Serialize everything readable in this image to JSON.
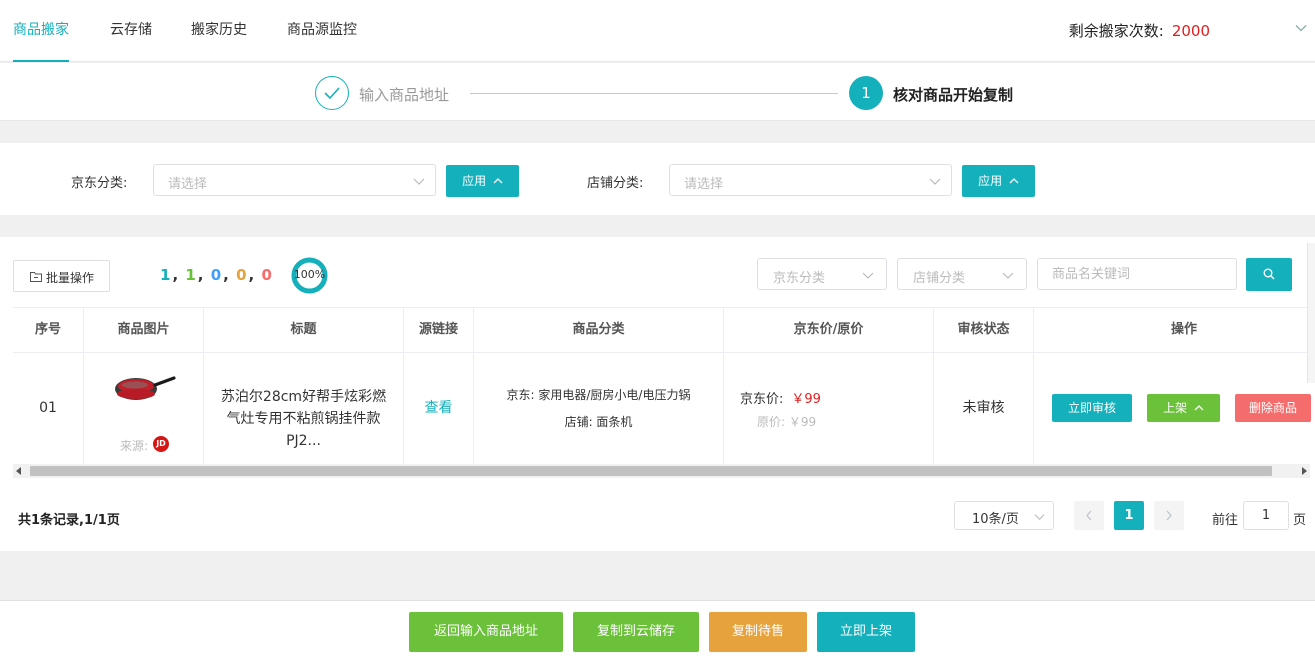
{
  "nav": {
    "tabs": [
      "商品搬家",
      "云存储",
      "搬家历史",
      "商品源监控"
    ],
    "remain_label": "剩余搬家次数:",
    "remain_value": "2000"
  },
  "steps": {
    "step1": "输入商品地址",
    "step2_num": "1",
    "step2": "核对商品开始复制"
  },
  "filter": {
    "jd_label": "京东分类:",
    "jd_placeholder": "请选择",
    "shop_label": "店铺分类:",
    "shop_placeholder": "请选择",
    "apply": "应用"
  },
  "toolbar": {
    "batch": "批量操作",
    "counts": [
      "1",
      "1",
      "0",
      "0",
      "0"
    ],
    "count_colors": [
      "#14b0bb",
      "#67c23a",
      "#409eff",
      "#e6a23c",
      "#f56c6c"
    ],
    "progress_text": "100%",
    "progress": 1.0,
    "jd_cat": "京东分类",
    "shop_cat": "店铺分类",
    "keyword_placeholder": "商品名关键词"
  },
  "table": {
    "headers": [
      "序号",
      "商品图片",
      "标题",
      "源链接",
      "商品分类",
      "京东价/原价",
      "审核状态",
      "操作"
    ],
    "row": {
      "seq": "01",
      "source_label": "来源:",
      "source_badge": "JD",
      "title": "苏泊尔28cm好帮手炫彩燃气灶专用不粘煎锅挂件款PJ2...",
      "link": "查看",
      "cat_jd": "京东: 家用电器/厨房小电/电压力锅",
      "cat_shop": "店铺: 面条机",
      "jd_price_label": "京东价:",
      "jd_price": "￥99",
      "orig_price": "原价: ￥99",
      "status": "未审核",
      "btn_review": "立即审核",
      "btn_shelf": "上架",
      "btn_delete": "删除商品"
    }
  },
  "pagination": {
    "total": "共1条记录,1/1页",
    "page_size": "10条/页",
    "current": "1",
    "goto_label": "前往",
    "goto_value": "1",
    "page_word": "页"
  },
  "bottom": {
    "back": "返回输入商品地址",
    "copy_cloud": "复制到云储存",
    "copy_pending": "复制待售",
    "publish": "立即上架"
  },
  "colors": {
    "teal": "#14b0bb",
    "green": "#6cc13a",
    "orange": "#e6a23c",
    "red": "#f56c6c",
    "price_red": "#e01e1e"
  }
}
